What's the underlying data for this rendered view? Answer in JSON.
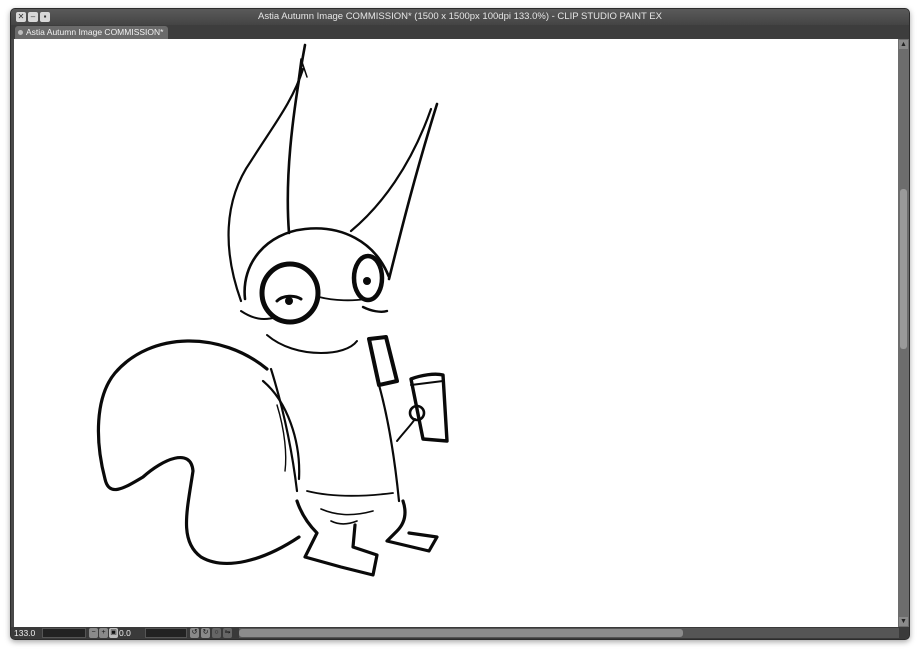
{
  "window": {
    "title": "Astia Autumn Image COMMISSION* (1500 x 1500px 100dpi 133.0%)  - CLIP STUDIO PAINT EX"
  },
  "tab": {
    "label": "Astia Autumn Image COMMISSION*"
  },
  "statusbar": {
    "zoom": "133.0",
    "rotation": "0.0"
  },
  "canvas": {
    "artwork": "squirrel-sketch"
  }
}
